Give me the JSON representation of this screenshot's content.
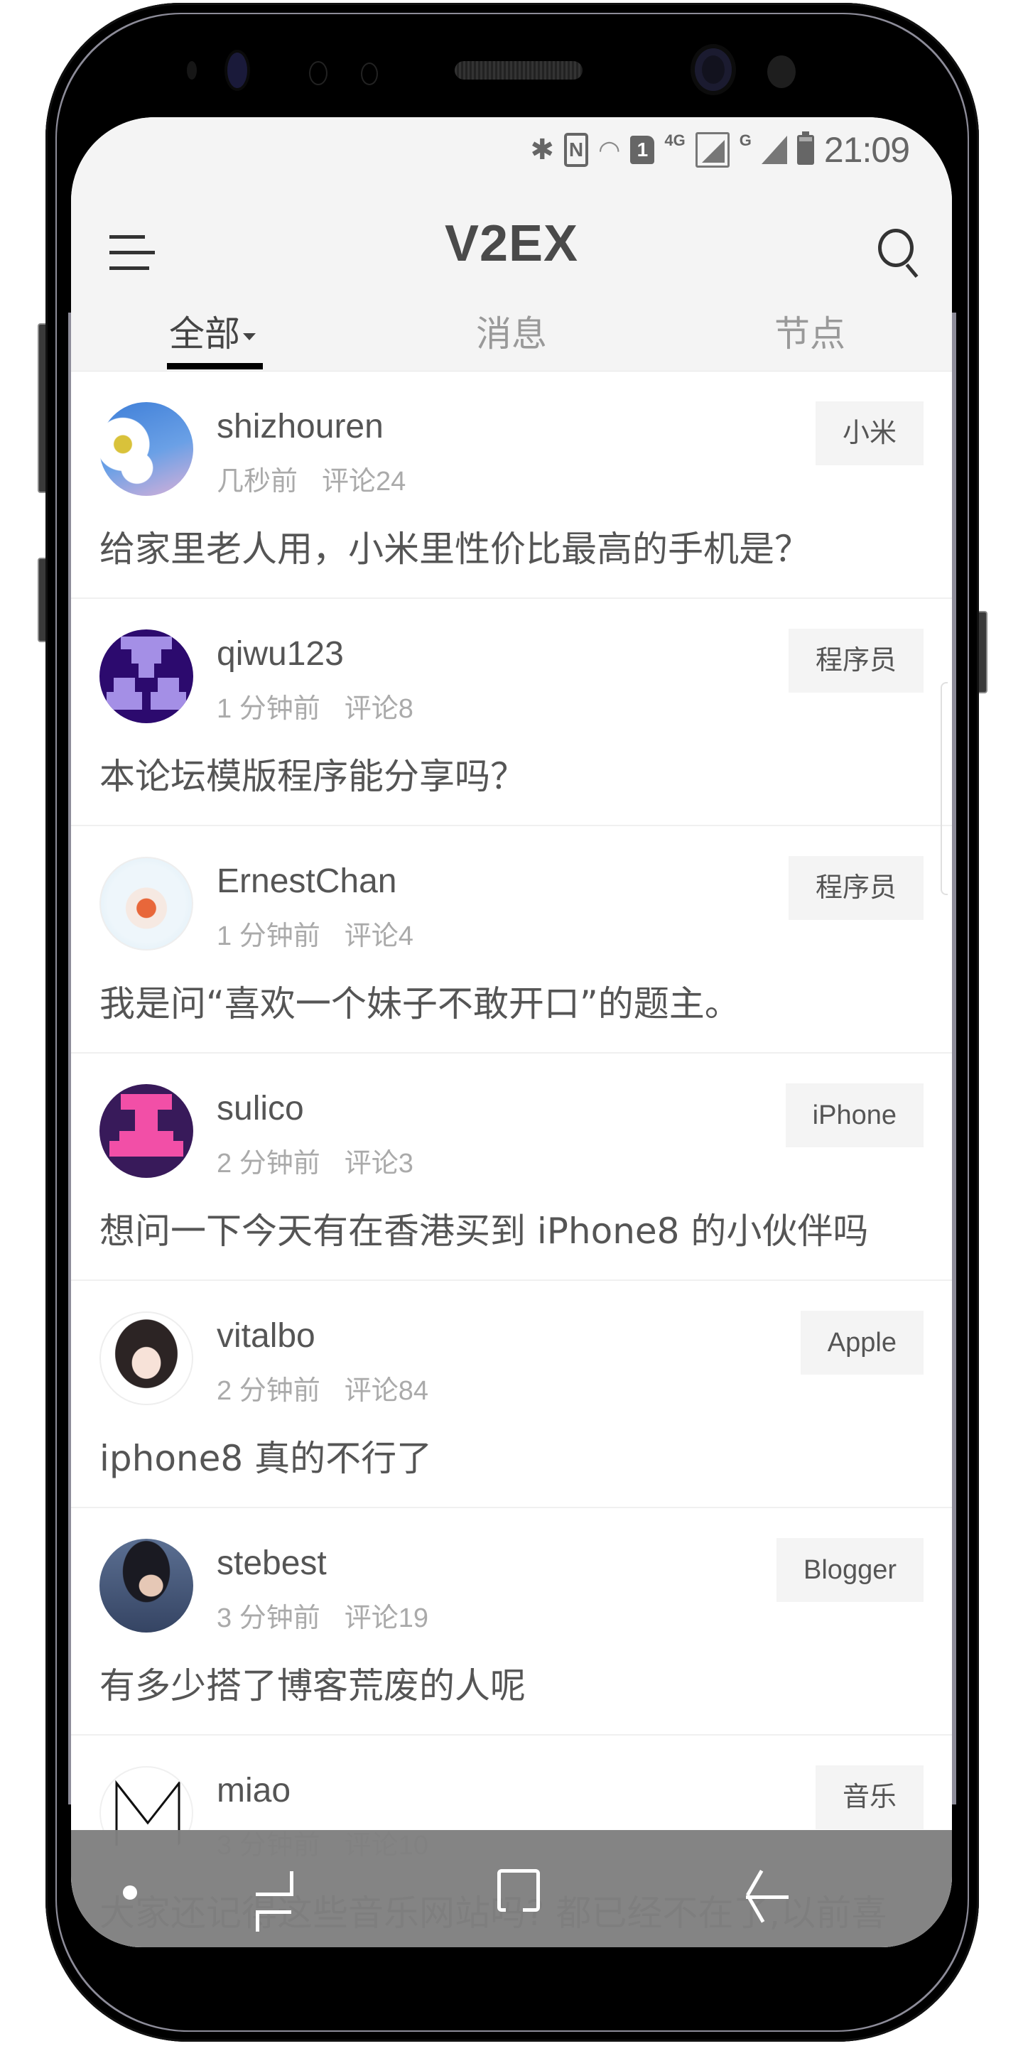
{
  "status_bar": {
    "time": "21:09",
    "icons": [
      "bluetooth-icon",
      "nfc-icon",
      "wifi-icon",
      "sim1-icon",
      "4g-signal-icon",
      "g-signal-icon",
      "battery-icon"
    ],
    "network_label_1": "4G",
    "network_label_2": "G",
    "sim_label": "1",
    "nfc_label": "N"
  },
  "header": {
    "title": "V2EX",
    "menu_icon": "hamburger-menu-icon",
    "search_icon": "search-icon"
  },
  "tabs": [
    {
      "label": "全部",
      "active": true,
      "has_dropdown": true
    },
    {
      "label": "消息",
      "active": false
    },
    {
      "label": "节点",
      "active": false
    }
  ],
  "topics": [
    {
      "username": "shizhouren",
      "time": "几秒前",
      "comments": "评论24",
      "node": "小米",
      "title": "给家里老人用，小米里性价比最高的手机是？"
    },
    {
      "username": "qiwu123",
      "time": "1 分钟前",
      "comments": "评论8",
      "node": "程序员",
      "title": "本论坛模版程序能分享吗？"
    },
    {
      "username": "ErnestChan",
      "time": "1 分钟前",
      "comments": "评论4",
      "node": "程序员",
      "title": "我是问“喜欢一个妹子不敢开口”的题主。"
    },
    {
      "username": "sulico",
      "time": "2 分钟前",
      "comments": "评论3",
      "node": "iPhone",
      "title": "想问一下今天有在香港买到 iPhone8 的小伙伴吗"
    },
    {
      "username": "vitalbo",
      "time": "2 分钟前",
      "comments": "评论84",
      "node": "Apple",
      "title": "iphone8 真的不行了"
    },
    {
      "username": "stebest",
      "time": "3 分钟前",
      "comments": "评论19",
      "node": "Blogger",
      "title": "有多少搭了博客荒废的人呢"
    },
    {
      "username": "miao",
      "time": "3 分钟前",
      "comments": "评论10",
      "node": "音乐",
      "title": "大家还记得这些音乐网站吗? 都已经不在了,以前喜"
    }
  ],
  "nav_bar": {
    "buttons": [
      "dot-indicator",
      "recent-apps-icon",
      "home-icon",
      "back-icon"
    ]
  }
}
